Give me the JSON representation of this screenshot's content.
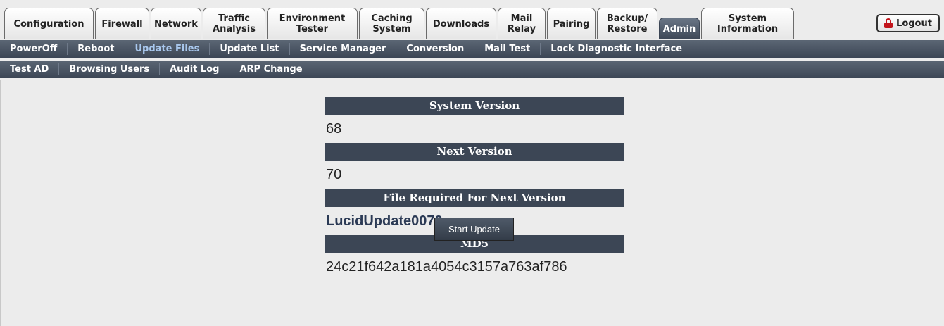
{
  "top_tabs": [
    "Configuration",
    "Firewall",
    "Network",
    "Traffic\nAnalysis",
    "Environment\nTester",
    "Caching\nSystem",
    "Downloads",
    "Mail\nRelay",
    "Pairing",
    "Backup/\nRestore",
    "Admin",
    "System\nInformation"
  ],
  "active_tab": "Admin",
  "logout_label": "Logout",
  "submenu_row1": [
    "PowerOff",
    "Reboot",
    "Update Files",
    "Update List",
    "Service Manager",
    "Conversion",
    "Mail Test",
    "Lock Diagnostic Interface"
  ],
  "submenu_row2": [
    "Test AD",
    "Browsing Users",
    "Audit Log",
    "ARP Change"
  ],
  "active_subitem": "Update Files",
  "update": {
    "system_version_header": "System Version",
    "system_version": "68",
    "next_version_header": "Next Version",
    "next_version": "70",
    "file_header": "File Required For Next Version",
    "file_name": "LucidUpdate0070.upg",
    "md5_header": "MD5",
    "md5": "24c21f642a181a4054c3157a763af786",
    "start_button": "Start Update"
  },
  "colors": {
    "header_bg": "#3c4655",
    "logout_lock": "#c2141b",
    "active_subitem": "#a9c8ee"
  }
}
